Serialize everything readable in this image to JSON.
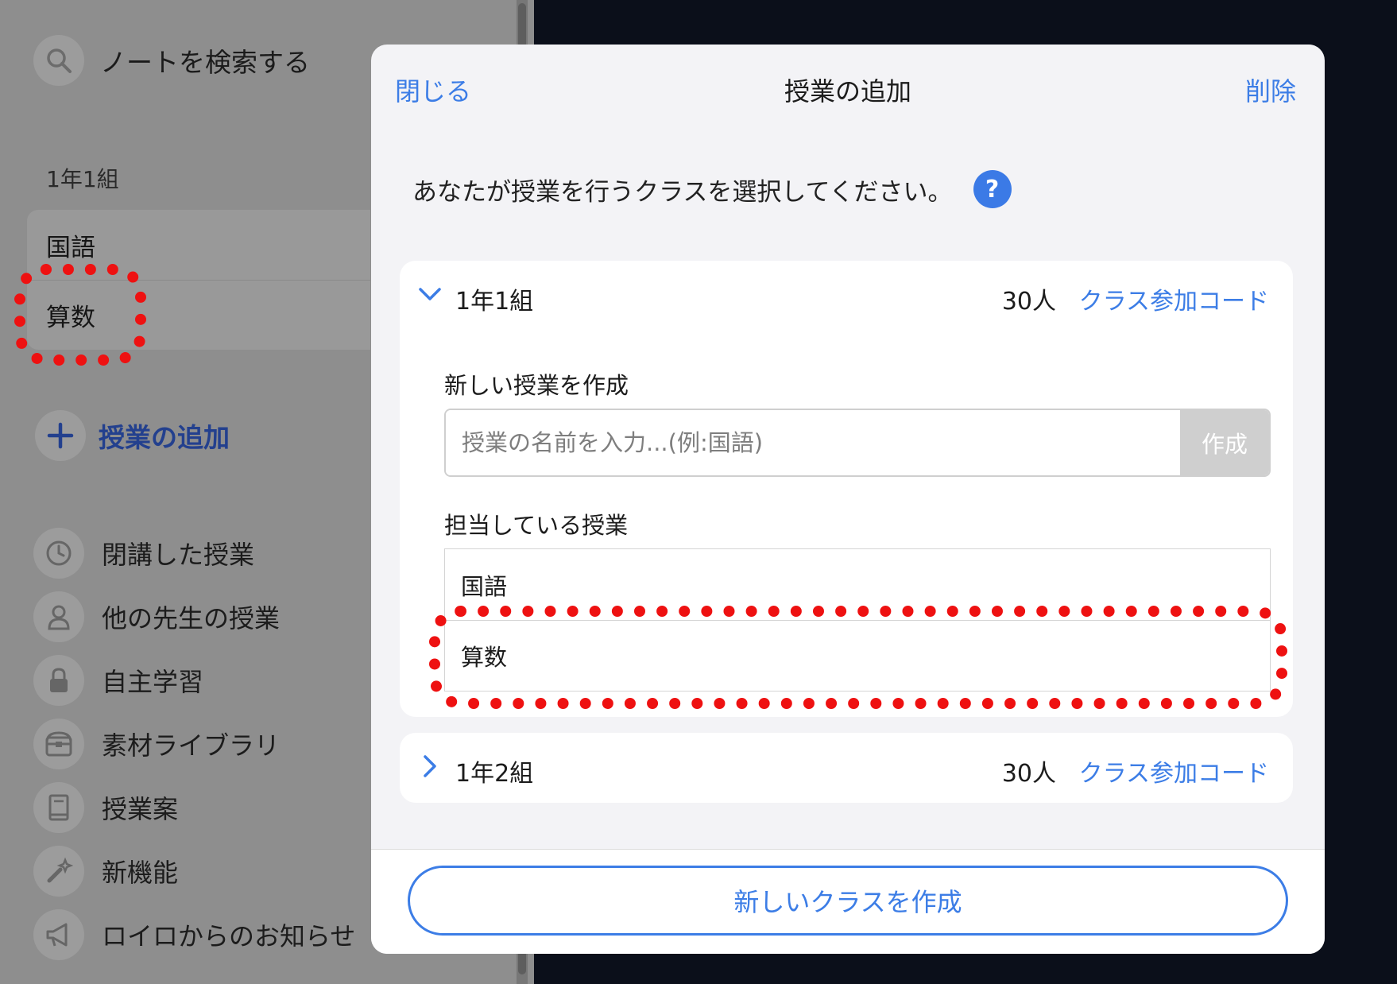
{
  "sidebar": {
    "search_label": "ノートを検索する",
    "class_heading": "1年1組",
    "subjects": [
      "国語",
      "算数"
    ],
    "add_lesson_label": "授業の追加",
    "menu": [
      {
        "label": "閉講した授業",
        "icon": "clock-icon"
      },
      {
        "label": "他の先生の授業",
        "icon": "person-icon"
      },
      {
        "label": "自主学習",
        "icon": "lock-icon"
      },
      {
        "label": "素材ライブラリ",
        "icon": "treasure-box-icon"
      },
      {
        "label": "授業案",
        "icon": "book-icon"
      },
      {
        "label": "新機能",
        "icon": "sparkle-wand-icon"
      },
      {
        "label": "ロイロからのお知らせ",
        "icon": "megaphone-icon"
      }
    ]
  },
  "modal": {
    "close_label": "閉じる",
    "title": "授業の追加",
    "delete_label": "削除",
    "instruction": "あなたが授業を行うクラスを選択してください。",
    "help_label": "?",
    "classes": [
      {
        "name": "1年1組",
        "count": "30人",
        "code_label": "クラス参加コード",
        "new_lesson_label": "新しい授業を作成",
        "input_placeholder": "授業の名前を入力...(例:国語)",
        "create_button": "作成",
        "assigned_label": "担当している授業",
        "lessons": [
          "国語",
          "算数"
        ]
      },
      {
        "name": "1年2組",
        "count": "30人",
        "code_label": "クラス参加コード"
      }
    ],
    "new_class_button": "新しいクラスを作成"
  },
  "colors": {
    "accent": "#3c7de6",
    "annotation": "#ee1111",
    "sidebar_dim": "#8e8e8e",
    "backdrop": "#0b0f1a"
  }
}
